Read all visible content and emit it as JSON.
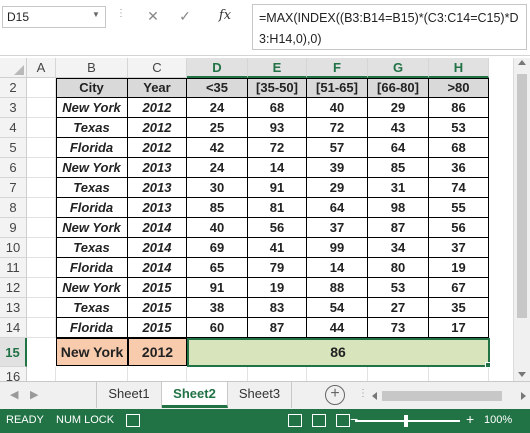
{
  "formula_bar": {
    "name_box": "D15",
    "cancel_glyph": "✕",
    "enter_glyph": "✓",
    "fx_glyph": "fx",
    "formula": "=MAX(INDEX((B3:B14=B15)*(C3:C14=C15)*D3:H14,0),0)"
  },
  "columns": [
    "A",
    "B",
    "C",
    "D",
    "E",
    "F",
    "G",
    "H"
  ],
  "rows": [
    "2",
    "3",
    "4",
    "5",
    "6",
    "7",
    "8",
    "9",
    "10",
    "11",
    "12",
    "13",
    "14",
    "15",
    "16"
  ],
  "table": {
    "headers": [
      "City",
      "Year",
      "<35",
      "[35-50]",
      "[51-65]",
      "[66-80]",
      ">80"
    ],
    "rows": [
      [
        "New York",
        "2012",
        "24",
        "68",
        "40",
        "29",
        "86"
      ],
      [
        "Texas",
        "2012",
        "25",
        "93",
        "72",
        "43",
        "53"
      ],
      [
        "Florida",
        "2012",
        "42",
        "72",
        "57",
        "64",
        "68"
      ],
      [
        "New York",
        "2013",
        "24",
        "14",
        "39",
        "85",
        "36"
      ],
      [
        "Texas",
        "2013",
        "30",
        "91",
        "29",
        "31",
        "74"
      ],
      [
        "Florida",
        "2013",
        "85",
        "81",
        "64",
        "98",
        "55"
      ],
      [
        "New York",
        "2014",
        "40",
        "56",
        "37",
        "87",
        "56"
      ],
      [
        "Texas",
        "2014",
        "69",
        "41",
        "99",
        "34",
        "37"
      ],
      [
        "Florida",
        "2014",
        "65",
        "79",
        "14",
        "80",
        "19"
      ],
      [
        "New York",
        "2015",
        "91",
        "19",
        "88",
        "53",
        "67"
      ],
      [
        "Texas",
        "2015",
        "38",
        "83",
        "54",
        "27",
        "35"
      ],
      [
        "Florida",
        "2015",
        "60",
        "87",
        "44",
        "73",
        "17"
      ]
    ]
  },
  "lookup": {
    "city": "New York",
    "year": "2012",
    "result": "86"
  },
  "sheets": [
    "Sheet1",
    "Sheet2",
    "Sheet3"
  ],
  "active_sheet": "Sheet2",
  "add_sheet_glyph": "+",
  "status": {
    "ready": "READY",
    "numlock": "NUM LOCK",
    "zoom": "100%",
    "zoom_out": "−",
    "zoom_in": "+"
  },
  "colors": {
    "accent": "#217346",
    "header_fill": "#d9d9d9",
    "city_fill": "#f8cbad",
    "result_fill": "#d8e4bc"
  }
}
